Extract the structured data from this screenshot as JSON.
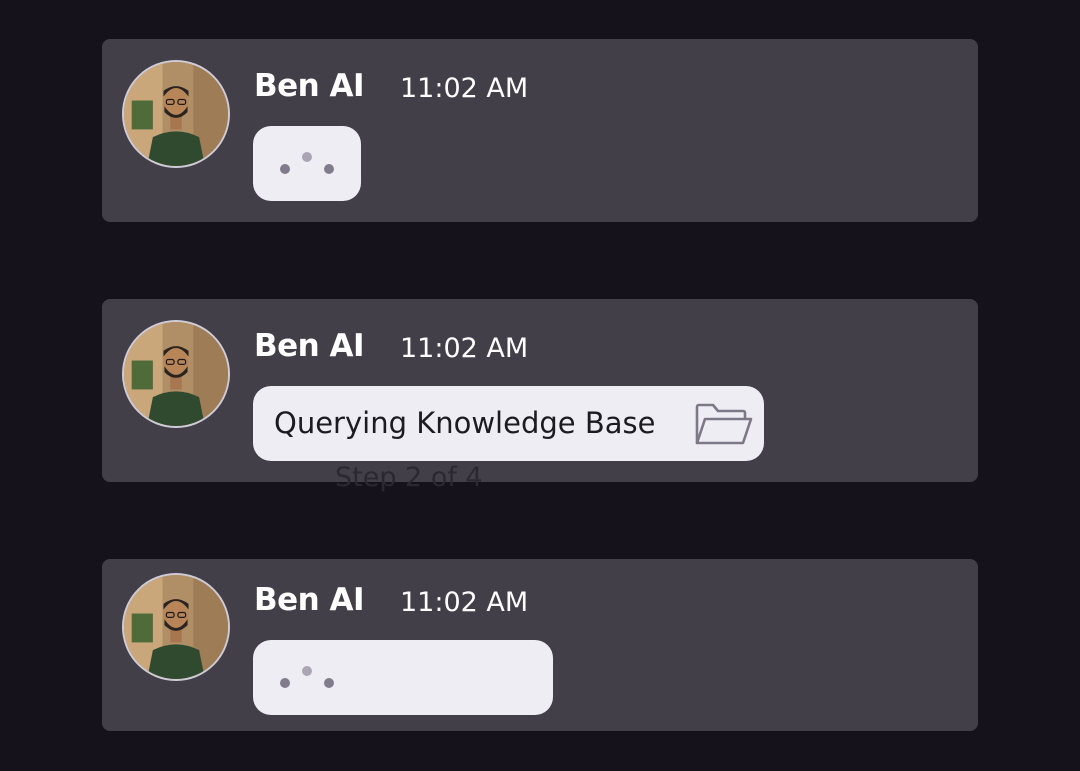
{
  "messages": [
    {
      "sender": "Ben AI",
      "time": "11:02 AM",
      "state": "typing"
    },
    {
      "sender": "Ben AI",
      "time": "11:02 AM",
      "state": "status",
      "status_text": "Querying Knowledge Base",
      "status_icon": "folder-icon",
      "step_text": "Step 2 of 4"
    },
    {
      "sender": "Ben AI",
      "time": "11:02 AM",
      "state": "typing"
    }
  ]
}
